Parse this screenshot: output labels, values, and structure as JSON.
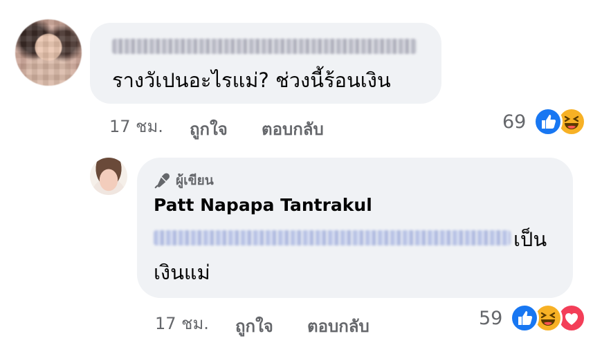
{
  "comment1": {
    "text": "รางวัเปนอะไรแม่? ช่วงนี้ร้อนเงิน",
    "time": "17 ชม.",
    "like_label": "ถูกใจ",
    "reply_label": "ตอบกลับ",
    "reaction_count": "69",
    "reactions": [
      "like-icon",
      "haha-icon"
    ]
  },
  "comment2": {
    "badge_label": "ผู้เขียน",
    "author_name": "Patt Napapa Tantrakul",
    "text_line1_end": "เป็น",
    "text_line2": "เงินแม่",
    "time": "17 ชม.",
    "like_label": "ถูกใจ",
    "reply_label": "ตอบกลับ",
    "reaction_count": "59",
    "reactions": [
      "like-icon",
      "haha-icon",
      "love-icon"
    ]
  },
  "colors": {
    "bubble": "#f0f2f5",
    "meta_text": "#65676b",
    "like": "#1877f2",
    "haha": "#f7b125",
    "love": "#f33e58"
  }
}
